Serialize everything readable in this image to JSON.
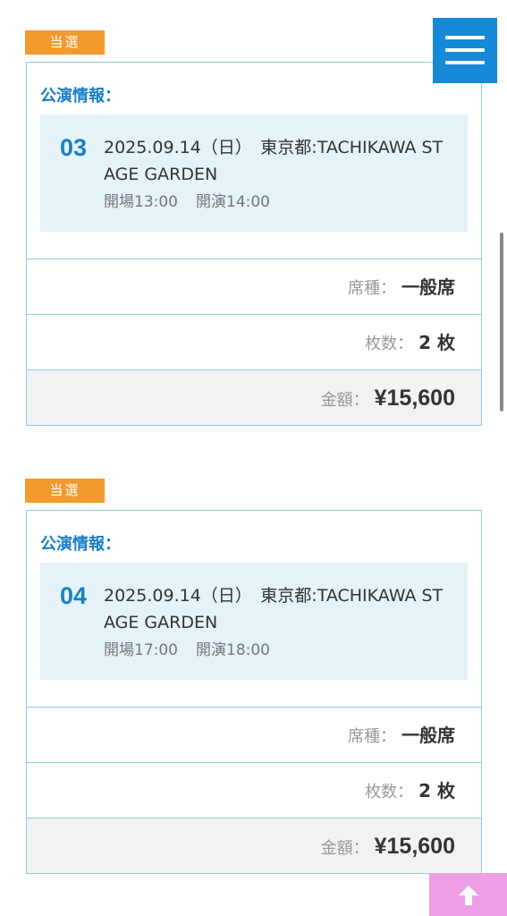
{
  "tickets": [
    {
      "badge": "当選",
      "label": "公演情報：",
      "number": "03",
      "description": "2025.09.14（日）　東京都:TACHIKAWA STAGE GARDEN",
      "open_time": "開場13:00",
      "start_time": "開演14:00",
      "seat_key": "席種：",
      "seat_value": "一般席",
      "count_key": "枚数：",
      "count_value": "2 枚",
      "amount_key": "金額：",
      "amount_value": "¥15,600"
    },
    {
      "badge": "当選",
      "label": "公演情報：",
      "number": "04",
      "description": "2025.09.14（日）　東京都:TACHIKAWA STAGE GARDEN",
      "open_time": "開場17:00",
      "start_time": "開演18:00",
      "seat_key": "席種：",
      "seat_value": "一般席",
      "count_key": "枚数：",
      "count_value": "2 枚",
      "amount_key": "金額：",
      "amount_value": "¥15,600"
    }
  ],
  "icons": {
    "menu": "hamburger-menu-icon",
    "back_to_top": "arrow-up-icon"
  },
  "colors": {
    "badge": "#f29a2e",
    "accent": "#1a7fc7",
    "menu_button": "#1589d6",
    "info_box": "#e5f2f8",
    "back_to_top": "#ee9ee6"
  }
}
